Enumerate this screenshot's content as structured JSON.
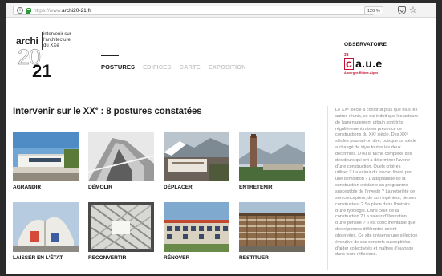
{
  "browser": {
    "url_prefix": "https://www.",
    "url_domain": "archi20-21.fr",
    "zoom": "120 %"
  },
  "header": {
    "logo_archi": "archi",
    "logo_subtitle_1": "intervenir sur",
    "logo_subtitle_2": "l'architecture",
    "logo_subtitle_3": "du XXè",
    "logo_20": "20",
    "logo_21": "21",
    "nav": [
      {
        "label": "POSTURES",
        "active": true
      },
      {
        "label": "EDIFICES",
        "active": false
      },
      {
        "label": "CARTE",
        "active": false
      },
      {
        "label": "EXPOSITION",
        "active": false
      }
    ],
    "observatoire": "OBSERVATOIRE",
    "caue_num": "38",
    "caue_c": "c",
    "caue_rest": "a.u.e",
    "caue_region": "Auvergne-Rhône-Alpes"
  },
  "main": {
    "heading_before": "Intervenir sur le XX",
    "heading_sup": "e",
    "heading_after": " : 8 postures constatées",
    "cards": [
      {
        "label": "AGRANDIR",
        "scene": "sky"
      },
      {
        "label": "DÉMOLIR",
        "scene": "concrete"
      },
      {
        "label": "DÉPLACER",
        "scene": "mountain"
      },
      {
        "label": "ENTRETENIR",
        "scene": "tower"
      },
      {
        "label": "LAISSER EN L'ÉTAT",
        "scene": "church"
      },
      {
        "label": "RECONVERTIR",
        "scene": "grid"
      },
      {
        "label": "RÉNOVER",
        "scene": "building"
      },
      {
        "label": "RESTITUER",
        "scene": "facade"
      }
    ]
  },
  "sidebar": {
    "lines": [
      "Le XXᵉ siècle a construit plus que tous les",
      "autres réunis, ce qui induit que les acteurs",
      "de l'aménagement urbain sont très",
      "régulièrement mis en présence de",
      "constructions du XXᵉ siècle. Des XXᵉ",
      "siècles pourrait-on dire, puisque ce siècle",
      "a changé de style toutes les deux",
      "décennies. D'où la tâche complexe des",
      "décideurs qui ont à déterminer l'avenir",
      "d'une construction. Quels critères",
      "utiliser ? La valeur du foncier libéré par",
      "une démolition ? L'adaptabilité de la",
      "construction existante au programme",
      "susceptible de l'investir ? La notoriété de",
      "son concepteur, de son ingénieur, de son",
      "constructeur ? Sa place dans l'histoire",
      "d'une typologie. Dans celle de la",
      "construction ? La valeur d'illustration",
      "d'une pensée ? Il est donc inévitable que",
      "des réponses différentes soient",
      "observées. Ce site présente une sélection",
      "évolutive de cas concrets susceptibles",
      "d'aider collectivités et maîtres d'ouvrage",
      "dans leurs réflexions."
    ]
  }
}
